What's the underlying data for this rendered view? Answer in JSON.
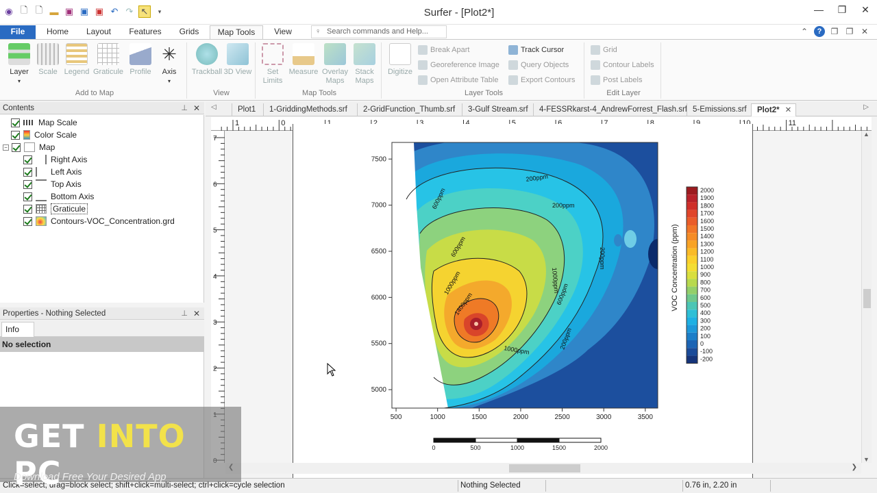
{
  "app": {
    "title": "Surfer - [Plot2*]"
  },
  "ribbon_tabs": [
    "File",
    "Home",
    "Layout",
    "Features",
    "Grids",
    "Map Tools",
    "View"
  ],
  "search": {
    "placeholder": "Search commands and Help..."
  },
  "ribbon": {
    "add_to_map": {
      "label": "Add to Map",
      "buttons": [
        "Layer",
        "Scale",
        "Legend",
        "Graticule",
        "Profile",
        "Axis"
      ]
    },
    "view": {
      "label": "View",
      "buttons": [
        "Trackball",
        "3D View"
      ]
    },
    "map_tools": {
      "label": "Map Tools",
      "buttons": [
        "Set Limits",
        "Measure",
        "Overlay Maps",
        "Stack Maps"
      ]
    },
    "layer_tools": {
      "label": "Layer Tools",
      "digitize": "Digitize",
      "items": [
        "Break Apart",
        "Georeference Image",
        "Open Attribute Table",
        "Track Cursor",
        "Query Objects",
        "Export Contours"
      ]
    },
    "edit_layer": {
      "label": "Edit Layer",
      "items": [
        "Grid",
        "Contour Labels",
        "Post Labels"
      ]
    }
  },
  "contents": {
    "title": "Contents",
    "items": [
      "Map Scale",
      "Color Scale",
      "Map",
      "Right Axis",
      "Left Axis",
      "Top Axis",
      "Bottom Axis",
      "Graticule",
      "Contours-VOC_Concentration.grd"
    ]
  },
  "properties": {
    "title": "Properties - Nothing Selected",
    "tab": "Info",
    "selection": "No selection"
  },
  "doc_tabs": [
    "Plot1",
    "1-GriddingMethods.srf",
    "2-GridFunction_Thumb.srf",
    "3-Gulf Stream.srf",
    "4-FESSRkarst-4_AndrewForrest_Flash.srf",
    "5-Emissions.srf",
    "Plot2*"
  ],
  "ruler": {
    "h": [
      "1",
      "0",
      "1",
      "2",
      "3",
      "4",
      "5",
      "6",
      "7",
      "8",
      "9",
      "10",
      "11"
    ],
    "v": [
      "7",
      "6",
      "5",
      "4",
      "3",
      "2",
      "1",
      "0"
    ]
  },
  "chart_data": {
    "type": "heatmap",
    "x_ticks": [
      "500",
      "1000",
      "1500",
      "2000",
      "2500",
      "3000",
      "3500"
    ],
    "y_ticks": [
      "7500",
      "7000",
      "6500",
      "6000",
      "5500",
      "5000"
    ],
    "contour_labels": [
      "200ppm",
      "600ppm",
      "200ppm",
      "600ppm",
      "1000ppm",
      "1400ppm",
      "1000ppm",
      "600ppm",
      "200ppm",
      "1000ppm",
      "200ppm"
    ],
    "colorbar": {
      "title": "VOC Concentration (ppm)",
      "labels": [
        "2000",
        "1900",
        "1800",
        "1700",
        "1600",
        "1500",
        "1400",
        "1300",
        "1200",
        "1100",
        "1000",
        "900",
        "800",
        "700",
        "600",
        "500",
        "400",
        "300",
        "200",
        "100",
        "0",
        "-100",
        "-200"
      ]
    },
    "scale_bar": [
      "0",
      "500",
      "1000",
      "1500",
      "2000"
    ]
  },
  "status": {
    "hint": "Click=select; drag=block select; shift+click=multi-select; ctrl+click=cycle selection",
    "selection": "Nothing Selected",
    "coords": "0.76 in, 2.20 in"
  },
  "watermark": {
    "part1": "GET ",
    "part2": "INTO",
    "part3": " PC",
    "sub": "Download Free Your Desired App"
  }
}
